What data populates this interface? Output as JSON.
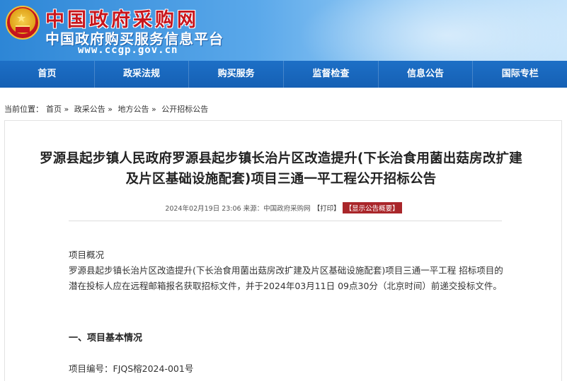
{
  "header": {
    "title": "中国政府采购网",
    "subtitle": "中国政府购买服务信息平台",
    "url": "www.ccgp.gov.cn"
  },
  "nav": {
    "items": [
      "首页",
      "政采法规",
      "购买服务",
      "监督检查",
      "信息公告",
      "国际专栏"
    ]
  },
  "breadcrumb": {
    "label": "当前位置：",
    "items": [
      "首页 »",
      "政采公告 »",
      "地方公告 »",
      "公开招标公告"
    ]
  },
  "article": {
    "title_line1": "罗源县起步镇人民政府罗源县起步镇长治片区改造提升(下长治食用菌出菇房改扩建",
    "title_line2": "及片区基础设施配套)项目三通一平工程公开招标公告",
    "meta": "2024年02月19日 23:06 来源：中国政府采购网",
    "print_label": "【打印】",
    "summary_badge": "【显示公告概要】",
    "overview_heading": "项目概况",
    "overview_text": "罗源县起步镇长治片区改造提升(下长治食用菌出菇房改扩建及片区基础设施配套)项目三通一平工程 招标项目的潜在投标人应在远程邮箱报名获取招标文件，并于2024年03月11日 09点30分（北京时间）前递交投标文件。",
    "section1_heading": "一、项目基本情况",
    "project_no": "项目编号：FJQS榕2024-001号"
  },
  "colors": {
    "nav_bg": "#1765ba",
    "title_red": "#c8161d",
    "badge_bg": "#a9262a"
  }
}
